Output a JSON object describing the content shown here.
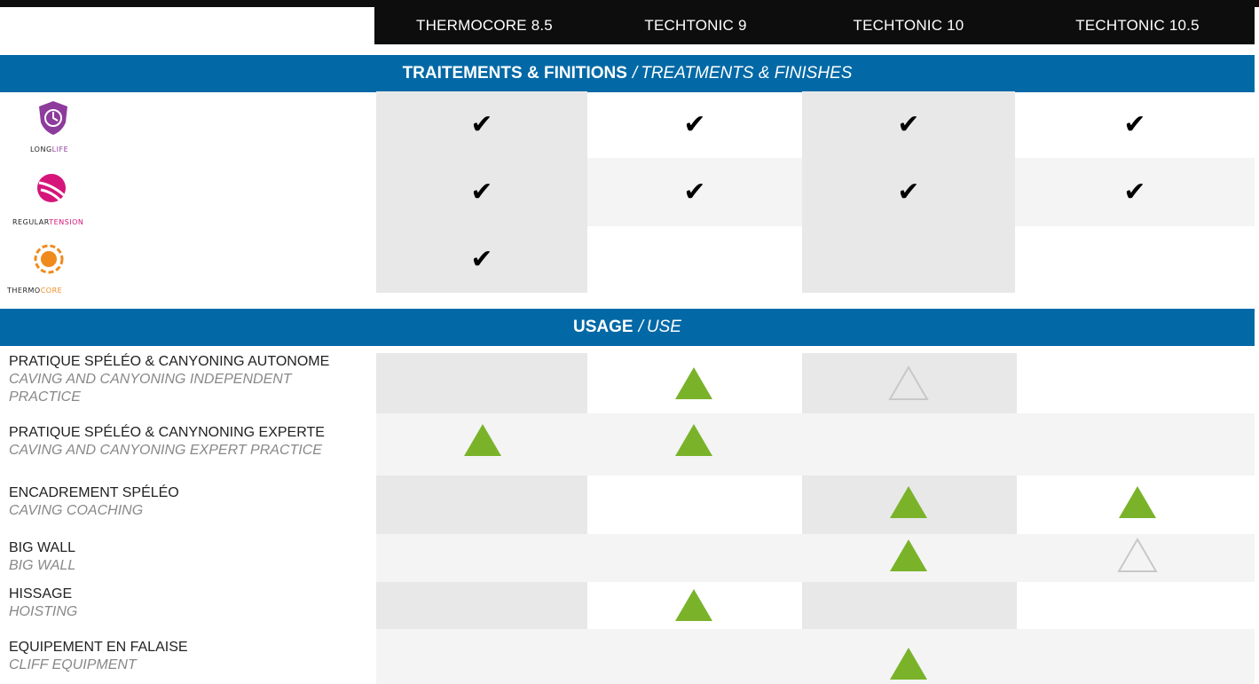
{
  "products": [
    "THERMOCORE 8.5",
    "TECHTONIC 9",
    "TECHTONIC 10",
    "TECHTONIC 10.5"
  ],
  "section_treatments": {
    "title_bold": "TRAITEMENTS & FINITIONS",
    "title_sep": "/",
    "title_italic": "TREATMENTS & FINISHES"
  },
  "treatments": [
    {
      "name": "longlife",
      "caption_a": "LONG",
      "caption_b": "LIFE",
      "caption_b_color": "#8d3b9c",
      "marks": [
        "✔",
        "✔",
        "✔",
        "✔"
      ]
    },
    {
      "name": "regulartension",
      "caption_a": "REGULAR",
      "caption_b": "TENSION",
      "caption_b_color": "#d6157a",
      "marks": [
        "✔",
        "✔",
        "✔",
        "✔"
      ]
    },
    {
      "name": "thermocore",
      "caption_a": "THERMO",
      "caption_b": "CORE",
      "caption_b_color": "#f08a1c",
      "marks": [
        "✔",
        "",
        "",
        ""
      ]
    }
  ],
  "section_usage": {
    "title_bold": "USAGE",
    "title_sep": "/",
    "title_italic": "USE"
  },
  "usage": [
    {
      "fr": "PRATIQUE SPÉLÉO & CANYONING AUTONOME",
      "en": "CAVING AND CANYONING INDEPENDENT PRACTICE",
      "marks": [
        "none",
        "filled",
        "outline",
        "none"
      ]
    },
    {
      "fr": "PRATIQUE SPÉLÉO & CANYNONING EXPERTE",
      "en": "CAVING AND CANYONING EXPERT PRACTICE",
      "marks": [
        "filled",
        "filled",
        "none",
        "none"
      ]
    },
    {
      "fr": "ENCADREMENT SPÉLÉO",
      "en": "CAVING COACHING",
      "marks": [
        "none",
        "none",
        "filled",
        "filled"
      ]
    },
    {
      "fr": "BIG WALL",
      "en": "BIG WALL",
      "marks": [
        "none",
        "none",
        "filled",
        "outline"
      ]
    },
    {
      "fr": "HISSAGE",
      "en": "HOISTING",
      "marks": [
        "none",
        "filled",
        "none",
        "none"
      ]
    },
    {
      "fr": "EQUIPEMENT EN FALAISE",
      "en": "CLIFF EQUIPMENT",
      "marks": [
        "none",
        "none",
        "filled",
        "none"
      ]
    }
  ],
  "colors": {
    "band": "#0269a6",
    "filled_triangle": "#7ab32a",
    "outline_triangle": "#c8c8c8"
  }
}
